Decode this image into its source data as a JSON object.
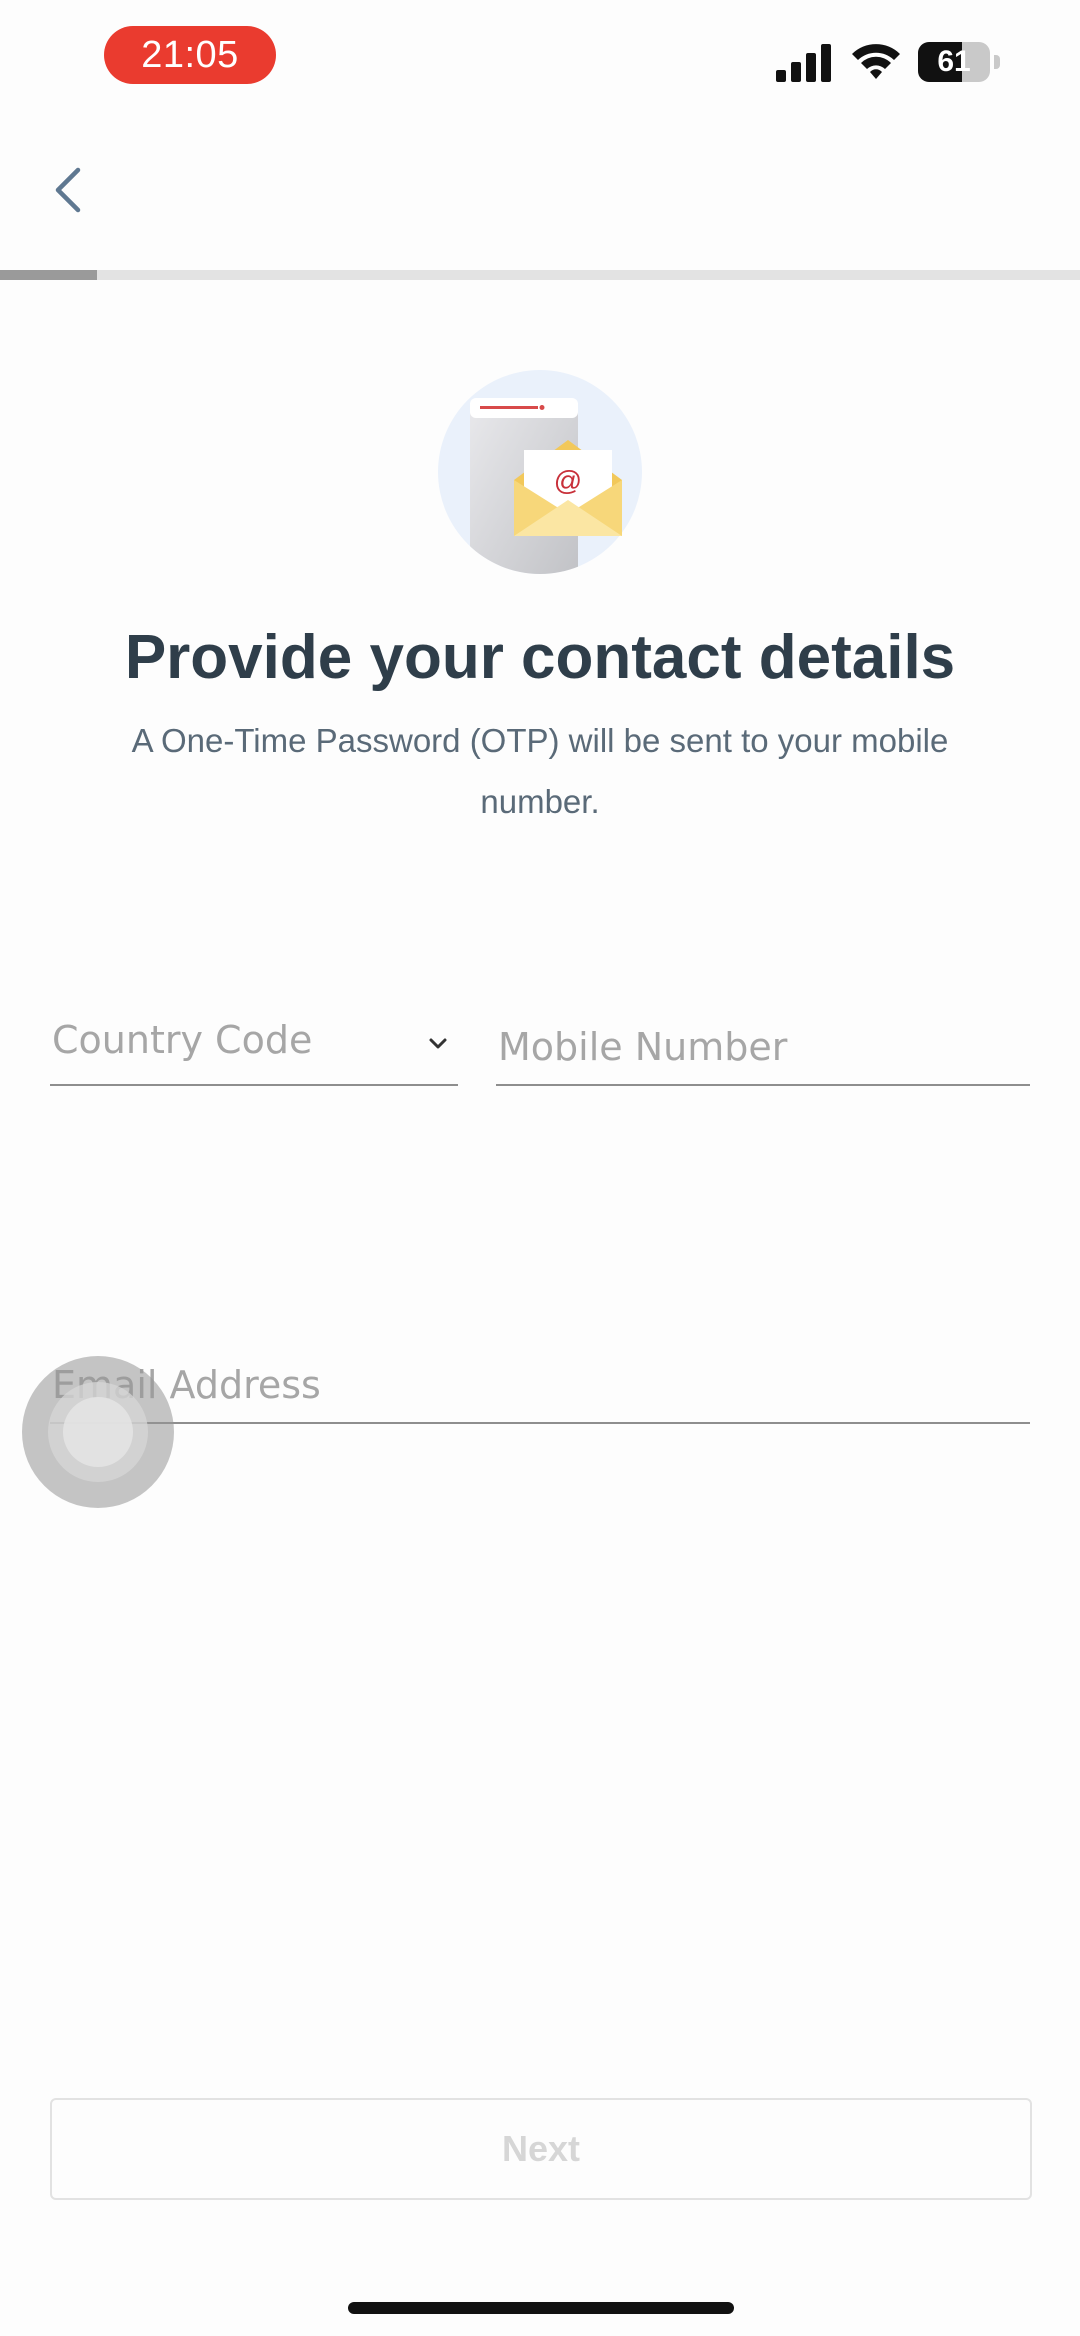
{
  "status_bar": {
    "time": "21:05",
    "battery_level": "61",
    "battery_fraction": 0.61
  },
  "header": {
    "back_icon": "chevron-left-icon",
    "progress_fraction": 0.09
  },
  "main": {
    "illustration_icon": "phone-envelope-at-illustration",
    "title": "Provide your contact details",
    "subtitle": "A One-Time Password (OTP) will be sent to your mobile number."
  },
  "form": {
    "country_code_placeholder": "Country Code",
    "country_code_icon": "chevron-down-icon",
    "mobile_number_placeholder": "Mobile Number",
    "email_placeholder": "Email Address"
  },
  "footer": {
    "next_label": "Next"
  },
  "colors": {
    "time_pill": "#ea3b2f",
    "title": "#2f3e4a",
    "subtitle": "#5a6a78",
    "accent_red": "#c8303a",
    "envelope": "#f7d77a"
  }
}
